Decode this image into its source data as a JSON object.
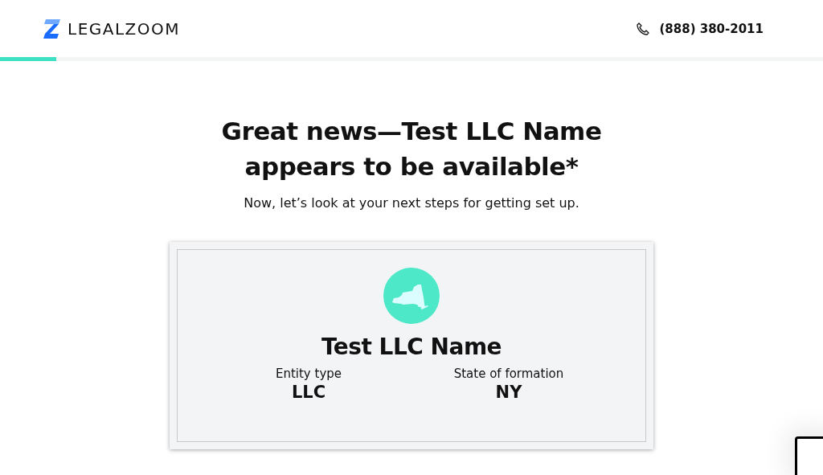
{
  "header": {
    "logo": "LEGALZOOM",
    "phone": "(888) 380-2011"
  },
  "progress": {
    "level": 0.068
  },
  "headline": "Great news—Test LLC Name appears to be available*",
  "subtitle": "Now, let’s look at your next steps for getting set up.",
  "card": {
    "name": "Test LLC Name",
    "details": [
      {
        "label": "Entity type",
        "value": "LLC"
      },
      {
        "label": "State of formation",
        "value": "NY"
      }
    ]
  }
}
